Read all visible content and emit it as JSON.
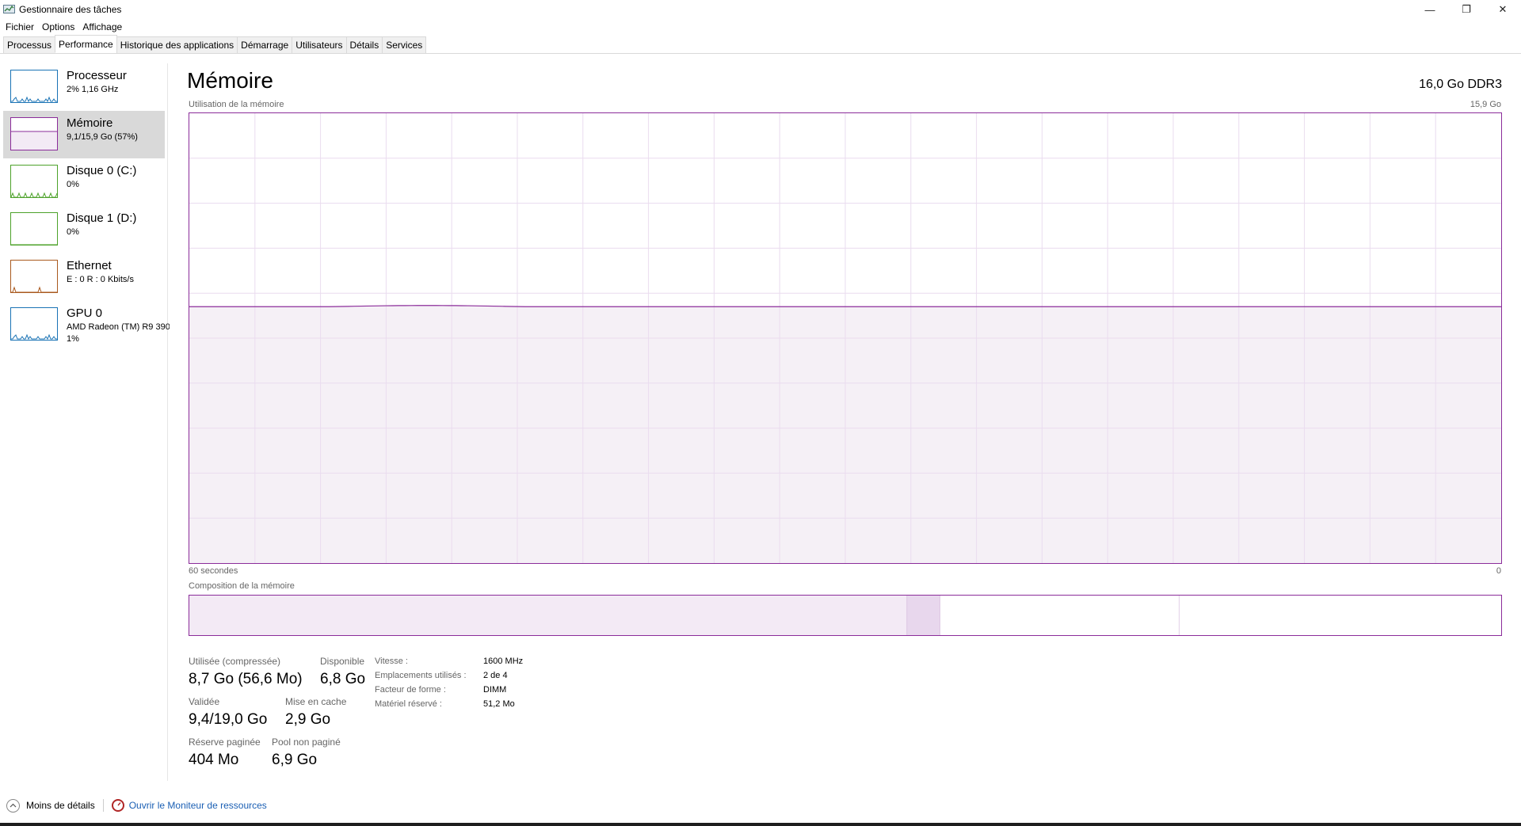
{
  "window": {
    "title": "Gestionnaire des tâches",
    "minimize": "—",
    "restore": "❐",
    "close": "✕"
  },
  "menu": [
    "Fichier",
    "Options",
    "Affichage"
  ],
  "tabs": [
    {
      "label": "Processus",
      "active": false
    },
    {
      "label": "Performance",
      "active": true
    },
    {
      "label": "Historique des applications",
      "active": false
    },
    {
      "label": "Démarrage",
      "active": false
    },
    {
      "label": "Utilisateurs",
      "active": false
    },
    {
      "label": "Détails",
      "active": false
    },
    {
      "label": "Services",
      "active": false
    }
  ],
  "sidebar": {
    "items": [
      {
        "name": "Processeur",
        "sub": "2%  1,16 GHz",
        "sub2": "",
        "color": "#1a73b5",
        "fill": "#e6f1fa",
        "selected": false
      },
      {
        "name": "Mémoire",
        "sub": "9,1/15,9 Go (57%)",
        "sub2": "",
        "color": "#8b2c9a",
        "fill": "#f3eaf5",
        "selected": true
      },
      {
        "name": "Disque 0 (C:)",
        "sub": "0%",
        "sub2": "",
        "color": "#4da22a",
        "fill": "#eef7e9",
        "selected": false
      },
      {
        "name": "Disque 1 (D:)",
        "sub": "0%",
        "sub2": "",
        "color": "#4da22a",
        "fill": "#eef7e9",
        "selected": false
      },
      {
        "name": "Ethernet",
        "sub": "E : 0  R : 0 Kbits/s",
        "sub2": "",
        "color": "#a9591e",
        "fill": "#f8efe8",
        "selected": false
      },
      {
        "name": "GPU 0",
        "sub": "AMD Radeon (TM) R9 390",
        "sub2": "1%",
        "color": "#1a73b5",
        "fill": "#e6f1fa",
        "selected": false
      }
    ]
  },
  "main": {
    "title": "Mémoire",
    "spec": "16,0 Go DDR3",
    "usage_label": "Utilisation de la mémoire",
    "usage_max": "15,9 Go",
    "time_left": "60 secondes",
    "time_right": "0",
    "composition_label": "Composition de la mémoire",
    "usage_fraction": 0.57,
    "accent": "#8b2c9a",
    "fill": "#f3edf5"
  },
  "composition": {
    "in_use": 8.7,
    "modified": 0.4,
    "standby": 2.9,
    "free": 3.9,
    "total": 15.9
  },
  "stats": {
    "used_label": "Utilisée (compressée)",
    "used_value": "8,7 Go (56,6 Mo)",
    "available_label": "Disponible",
    "available_value": "6,8 Go",
    "committed_label": "Validée",
    "committed_value": "9,4/19,0 Go",
    "cached_label": "Mise en cache",
    "cached_value": "2,9 Go",
    "paged_label": "Réserve paginée",
    "paged_value": "404 Mo",
    "nonpaged_label": "Pool non paginé",
    "nonpaged_value": "6,9 Go"
  },
  "props": [
    {
      "label": "Vitesse :",
      "value": "1600 MHz"
    },
    {
      "label": "Emplacements utilisés :",
      "value": "2 de 4"
    },
    {
      "label": "Facteur de forme :",
      "value": "DIMM"
    },
    {
      "label": "Matériel réservé :",
      "value": "51,2 Mo"
    }
  ],
  "footer": {
    "less_details": "Moins de détails",
    "resource_monitor": "Ouvrir le Moniteur de ressources"
  }
}
